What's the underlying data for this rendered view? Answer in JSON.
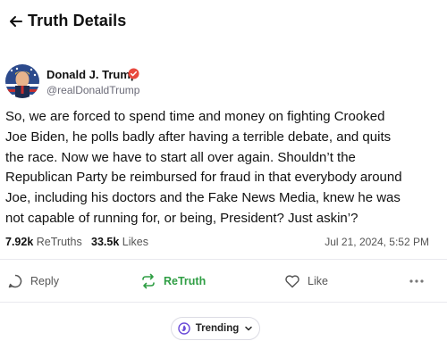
{
  "header": {
    "title": "Truth Details"
  },
  "author": {
    "name": "Donald J. Trump",
    "handle": "@realDonaldTrump"
  },
  "post": {
    "text": "So, we are forced to spend time and money on fighting Crooked\nJoe Biden, he polls badly after having a terrible debate, and quits\nthe race. Now we have to start all over again. Shouldn’t the\nRepublican Party be reimbursed for fraud in that everybody around\nJoe, including his doctors and the Fake News Media, knew he was\nnot capable of running for, or being, President?  Just askin’?"
  },
  "stats": {
    "retruths_count": "7.92k",
    "retruths_label": "ReTruths",
    "likes_count": "33.5k",
    "likes_label": "Likes",
    "timestamp": "Jul 21, 2024, 5:52 PM"
  },
  "actions": {
    "reply": "Reply",
    "retruth": "ReTruth",
    "like": "Like"
  },
  "trending": {
    "label": "Trending"
  },
  "colors": {
    "accent_purple": "#6a4bd8",
    "retruth_green": "#2f9e44",
    "verified_badge": "#e8493e"
  }
}
